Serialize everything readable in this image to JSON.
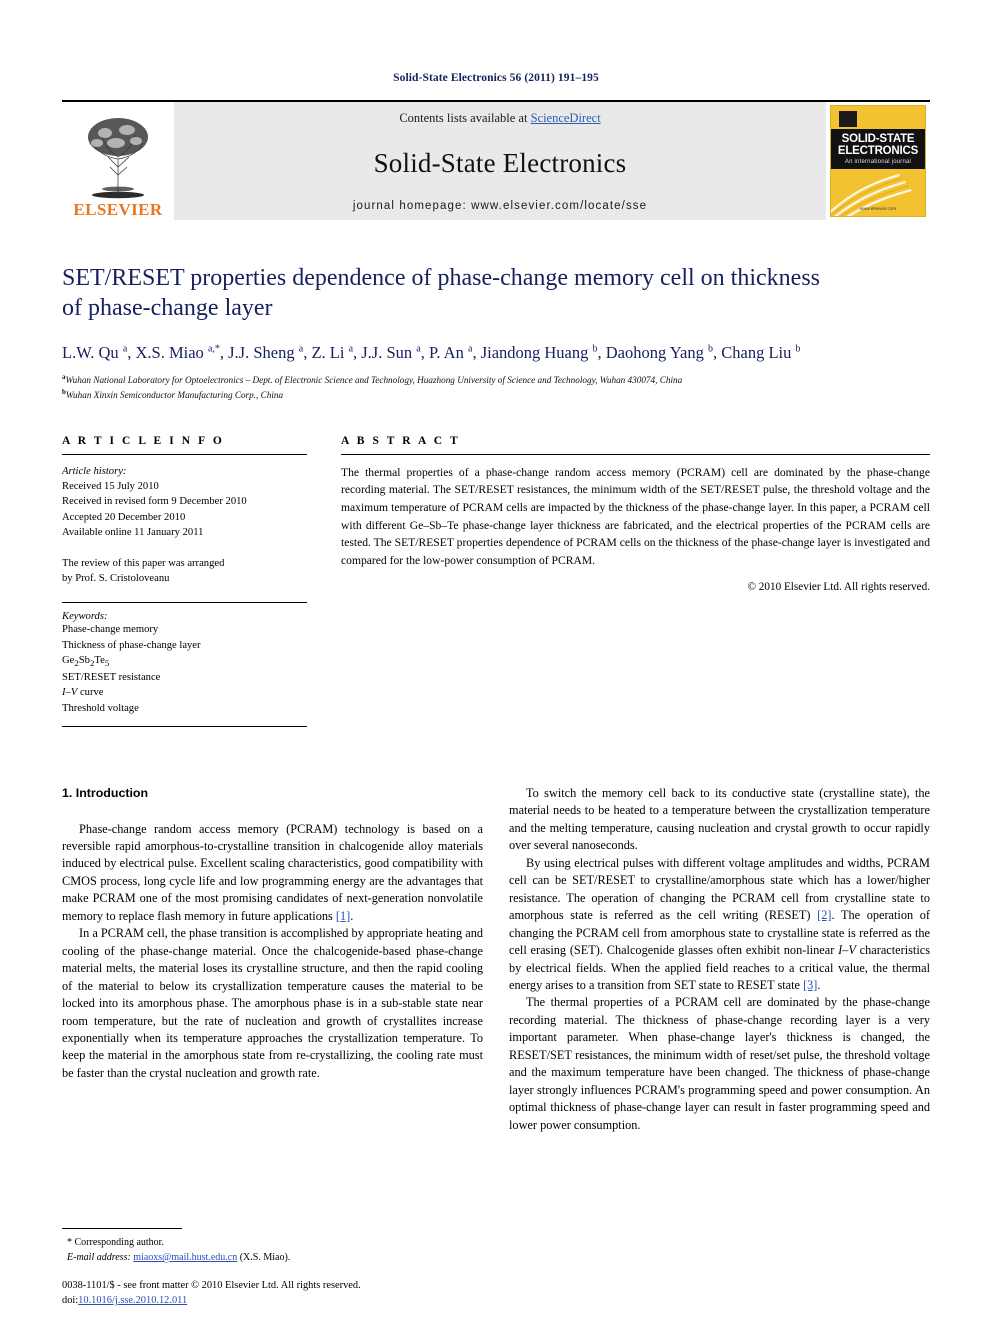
{
  "running_head": "Solid-State Electronics 56 (2011) 191–195",
  "masthead": {
    "elsevier_wordmark": "ELSEVIER",
    "contents_prefix": "Contents lists available at ",
    "sciencedirect": "ScienceDirect",
    "journal_title": "Solid-State Electronics",
    "homepage": "journal homepage: www.elsevier.com/locate/sse",
    "cover": {
      "line1": "SOLID-STATE",
      "line2": "ELECTRONICS",
      "subtitle": "An international journal",
      "footer": "www.elsevier.com"
    }
  },
  "article": {
    "title_line1": "SET/RESET properties dependence of phase-change memory cell on thickness",
    "title_line2": "of phase-change layer",
    "authors": "L.W. Qu a, X.S. Miao a,*, J.J. Sheng a, Z. Li a, J.J. Sun a, P. An a, Jiandong Huang b, Daohong Yang b, Chang Liu b",
    "affiliation_a": "Wuhan National Laboratory for Optoelectronics – Dept. of Electronic Science and Technology, Huazhong University of Science and Technology, Wuhan 430074, China",
    "affiliation_b": "Wuhan Xinxin Semiconductor Manufacturing Corp., China"
  },
  "article_info": {
    "heading": "A R T I C L E   I N F O",
    "history_label": "Article history:",
    "received": "Received 15 July 2010",
    "revised": "Received in revised form 9 December 2010",
    "accepted": "Accepted 20 December 2010",
    "online": "Available online 11 January 2011",
    "review_line1": "The review of this paper was arranged",
    "review_line2": "by Prof. S. Cristoloveanu",
    "keywords_label": "Keywords:",
    "keywords": [
      "Phase-change memory",
      "Thickness of phase-change layer",
      "Ge2Sb2Te5",
      "SET/RESET resistance",
      "I–V curve",
      "Threshold voltage"
    ]
  },
  "abstract": {
    "heading": "A B S T R A C T",
    "text": "The thermal properties of a phase-change random access memory (PCRAM) cell are dominated by the phase-change recording material. The SET/RESET resistances, the minimum width of the SET/RESET pulse, the threshold voltage and the maximum temperature of PCRAM cells are impacted by the thickness of the phase-change layer. In this paper, a PCRAM cell with different Ge–Sb–Te phase-change layer thickness are fabricated, and the electrical properties of the PCRAM cells are tested. The SET/RESET properties dependence of PCRAM cells on the thickness of the phase-change layer is investigated and compared for the low-power consumption of PCRAM.",
    "copyright": "© 2010 Elsevier Ltd. All rights reserved."
  },
  "body": {
    "section_heading": "1. Introduction",
    "left_p1_a": "Phase-change random access memory (PCRAM) technology is based on a reversible rapid amorphous-to-crystalline transition in chalcogenide alloy materials induced by electrical pulse. Excellent scaling characteristics, good compatibility with CMOS process, long cycle life and low programming energy are the advantages that make PCRAM one of the most promising candidates of next-generation nonvolatile memory to replace flash memory in future applications ",
    "left_p1_ref": "[1]",
    "left_p1_b": ".",
    "left_p2": "In a PCRAM cell, the phase transition is accomplished by appropriate heating and cooling of the phase-change material. Once the chalcogenide-based phase-change material melts, the material loses its crystalline structure, and then the rapid cooling of the material to below its crystallization temperature causes the material to be locked into its amorphous phase. The amorphous phase is in a sub-stable state near room temperature, but the rate of nucleation and growth of crystallites increase exponentially when its temperature approaches the crystallization temperature. To keep the material in the amorphous state from re-crystallizing, the cooling rate must be faster than the crystal nucleation and growth rate.",
    "right_p1": "To switch the memory cell back to its conductive state (crystalline state), the material needs to be heated to a temperature between the crystallization temperature and the melting temperature, causing nucleation and crystal growth to occur rapidly over several nanoseconds.",
    "right_p2_a": "By using electrical pulses with different voltage amplitudes and widths, PCRAM cell can be SET/RESET to crystalline/amorphous state which has a lower/higher resistance. The operation of changing the PCRAM cell from crystalline state to amorphous state is referred as the cell writing (RESET) ",
    "right_p2_ref1": "[2]",
    "right_p2_b": ". The operation of changing the PCRAM cell from amorphous state to crystalline state is referred as the cell erasing (SET). Chalcogenide glasses often exhibit non-linear ",
    "right_p2_iv": "I–V",
    "right_p2_c": " characteristics by electrical fields. When the applied field reaches to a critical value, the thermal energy arises to a transition from SET state to RESET state ",
    "right_p2_ref2": "[3]",
    "right_p2_d": ".",
    "right_p3": "The thermal properties of a PCRAM cell are dominated by the phase-change recording material. The thickness of phase-change recording layer is a very important parameter. When phase-change layer's thickness is changed, the RESET/SET resistances, the minimum width of reset/set pulse, the threshold voltage and the maximum temperature have been changed. The thickness of phase-change layer strongly influences PCRAM's programming speed and power consumption. An optimal thickness of phase-change layer can result in faster programming speed and lower power consumption."
  },
  "footnotes": {
    "corresponding": "* Corresponding author.",
    "email_label": "E-mail address:",
    "email": "miaoxs@mail.hust.edu.cn",
    "email_suffix": " (X.S. Miao).",
    "issn_line": "0038-1101/$ - see front matter © 2010 Elsevier Ltd. All rights reserved.",
    "doi_label": "doi:",
    "doi_value": "10.1016/j.sse.2010.12.011"
  }
}
